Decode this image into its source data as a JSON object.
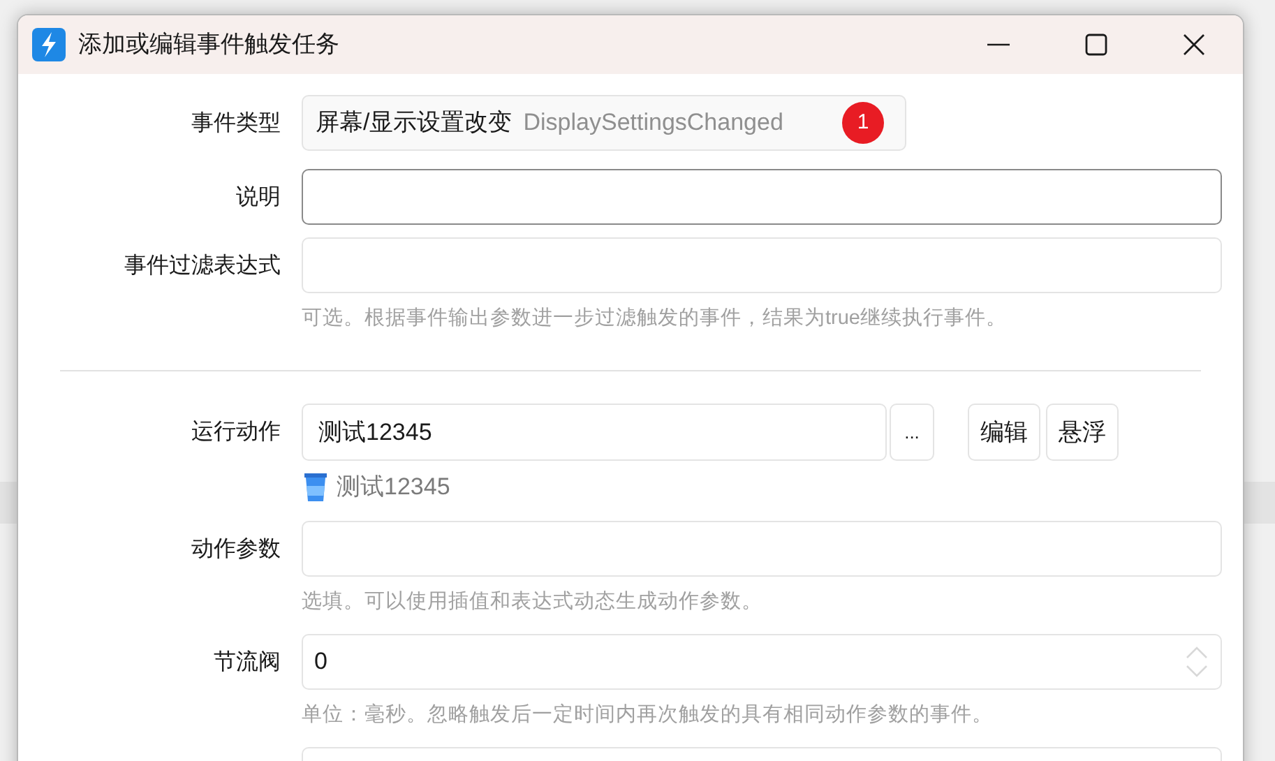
{
  "window": {
    "title": "添加或编辑事件触发任务"
  },
  "fields": [
    {
      "kind": "select",
      "label": "事件类型",
      "value": "屏幕/显示设置改变",
      "secondary": "DisplaySettingsChanged",
      "badge": "1"
    },
    {
      "kind": "text",
      "label": "说明",
      "focused": true
    },
    {
      "kind": "text",
      "label": "事件过滤表达式",
      "focused": false,
      "hint": "可选。根据事件输出参数进一步过滤触发的事件，结果为true继续执行事件。"
    },
    {
      "kind": "divider"
    },
    {
      "kind": "action",
      "label": "运行动作",
      "value": "测试12345",
      "browse": "...",
      "buttons": [
        "编辑",
        "悬浮"
      ],
      "chosen": "测试12345"
    },
    {
      "kind": "text",
      "label": "动作参数",
      "focused": false,
      "hint": "选填。可以使用插值和表达式动态生成动作参数。"
    },
    {
      "kind": "number",
      "label": "节流阀",
      "value": "0",
      "hint": "单位：毫秒。忽略触发后一定时间内再次触发的具有相同动作参数的事件。"
    },
    {
      "kind": "text",
      "focused": false
    }
  ]
}
